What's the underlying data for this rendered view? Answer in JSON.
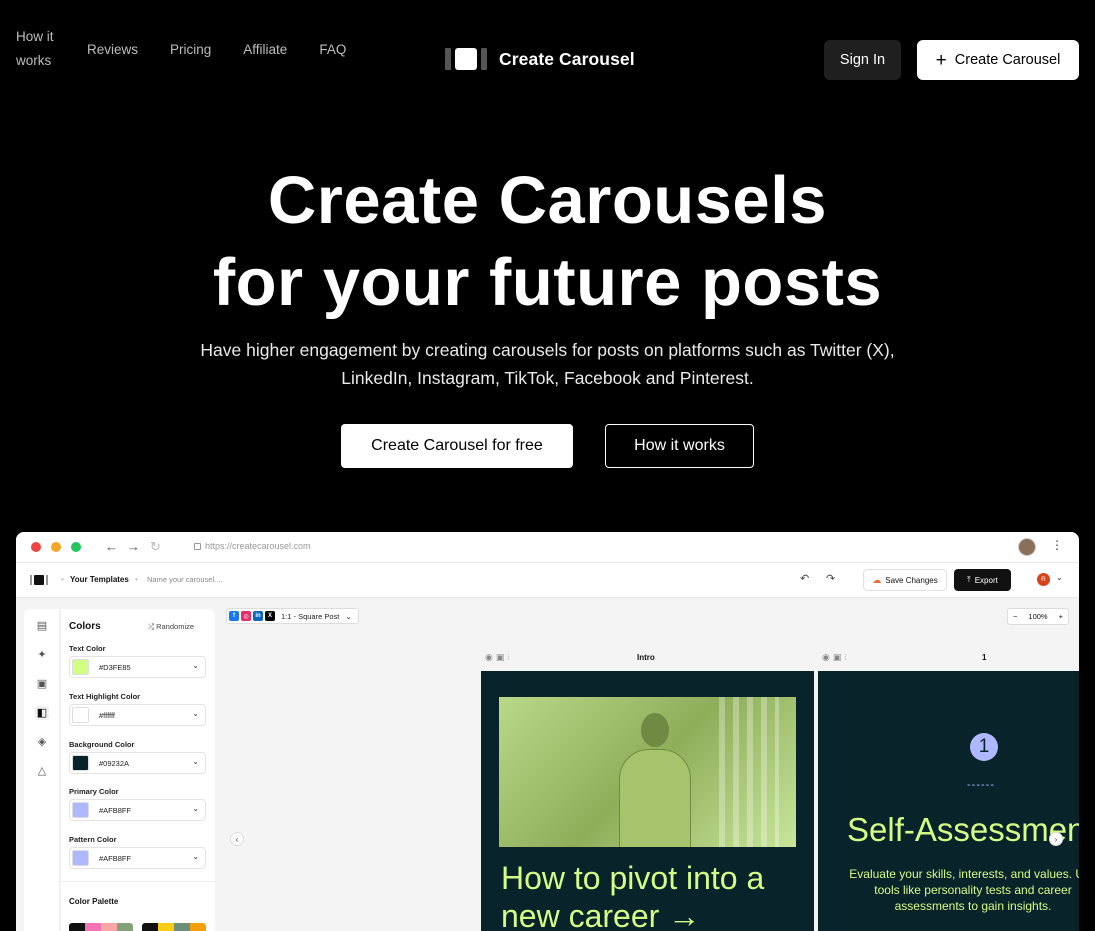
{
  "nav": {
    "links": [
      "How it works",
      "Reviews",
      "Pricing",
      "Affiliate",
      "FAQ"
    ],
    "brand": "Create Carousel",
    "sign_in": "Sign In",
    "create": "Create Carousel"
  },
  "hero": {
    "title_line1": "Create Carousels",
    "title_line2": "for your future posts",
    "subtitle": "Have higher engagement by creating carousels for posts on platforms such as Twitter (X), LinkedIn, Instagram, TikTok, Facebook and Pinterest.",
    "cta_primary": "Create Carousel for free",
    "cta_secondary": "How it works"
  },
  "app": {
    "url": "https://createcarousel.com",
    "breadcrumb": "Your Templates",
    "name_placeholder": "Name your carousel....",
    "save": "Save Changes",
    "export": "Export",
    "user_initial": "R",
    "panel_title": "Colors",
    "randomize": "Randomize",
    "fields": [
      {
        "label": "Text Color",
        "value": "#D3FE85",
        "color": "#D3FE85"
      },
      {
        "label": "Text Highlight Color",
        "value": "#ffffff",
        "color": "#ffffff"
      },
      {
        "label": "Background Color",
        "value": "#09232A",
        "color": "#09232A"
      },
      {
        "label": "Primary Color",
        "value": "#AFB8FF",
        "color": "#AFB8FF"
      },
      {
        "label": "Pattern Color",
        "value": "#AFB8FF",
        "color": "#AFB8FF"
      }
    ],
    "palette_label": "Color Palette",
    "format": "1:1 - Square Post",
    "zoom": "100%",
    "slide1_label": "Intro",
    "slide1_title": "How to pivot into a new career →",
    "slide2_label": "1",
    "slide2_number": "1",
    "slide2_title": "Self-Assessment",
    "slide2_body": "Evaluate your skills, interests, and values. Use tools like personality tests and career assessments to gain insights."
  }
}
